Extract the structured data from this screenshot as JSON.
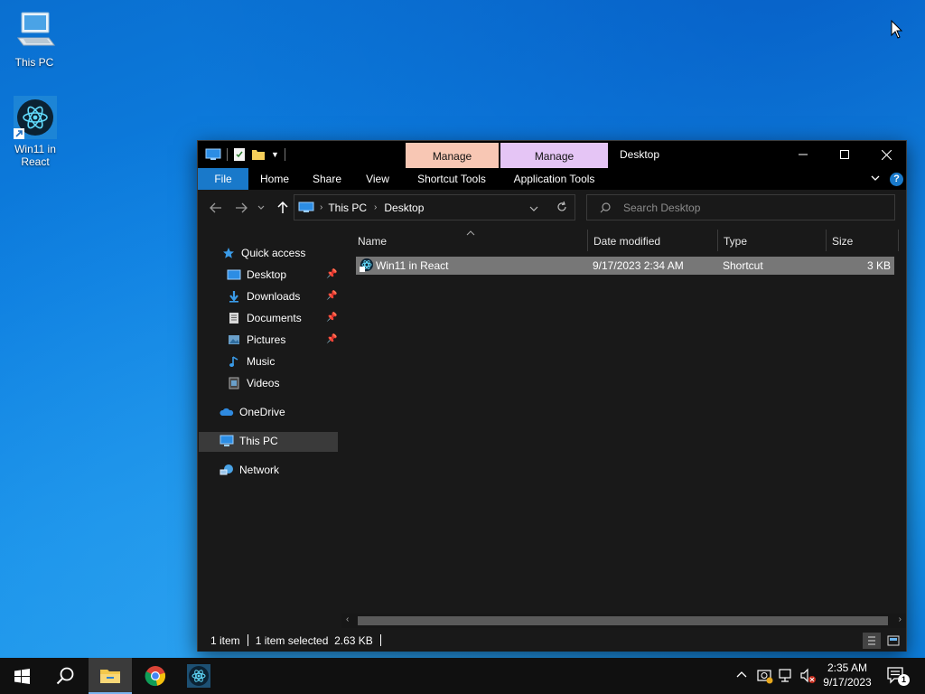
{
  "desktop": {
    "icons": [
      {
        "label_line1": "This PC",
        "label_line2": ""
      },
      {
        "label_line1": "Win11 in",
        "label_line2": "React"
      }
    ]
  },
  "window": {
    "title": "Desktop",
    "context_tabs": [
      "Manage",
      "Manage"
    ],
    "ribbon_tabs": [
      "File",
      "Home",
      "Share",
      "View",
      "Shortcut Tools",
      "Application Tools"
    ],
    "address": {
      "root": "This PC",
      "current": "Desktop"
    },
    "search_placeholder": "Search Desktop",
    "sidebar": {
      "quick_access": "Quick access",
      "items": [
        "Desktop",
        "Downloads",
        "Documents",
        "Pictures",
        "Music",
        "Videos"
      ],
      "onedrive": "OneDrive",
      "this_pc": "This PC",
      "network": "Network"
    },
    "columns": {
      "name": "Name",
      "date": "Date modified",
      "type": "Type",
      "size": "Size"
    },
    "files": [
      {
        "name": "Win11 in React",
        "date": "9/17/2023 2:34 AM",
        "type": "Shortcut",
        "size": "3 KB"
      }
    ],
    "status": {
      "count": "1 item",
      "selection": "1 item selected  2.63 KB"
    }
  },
  "taskbar": {
    "time": "2:35 AM",
    "date": "9/17/2023",
    "notification_count": "1"
  },
  "colors": {
    "accent": "#1979ca",
    "selection_row": "#777777",
    "manage_shortcut": "#f8c7b4",
    "manage_app": "#e5c5f5"
  }
}
